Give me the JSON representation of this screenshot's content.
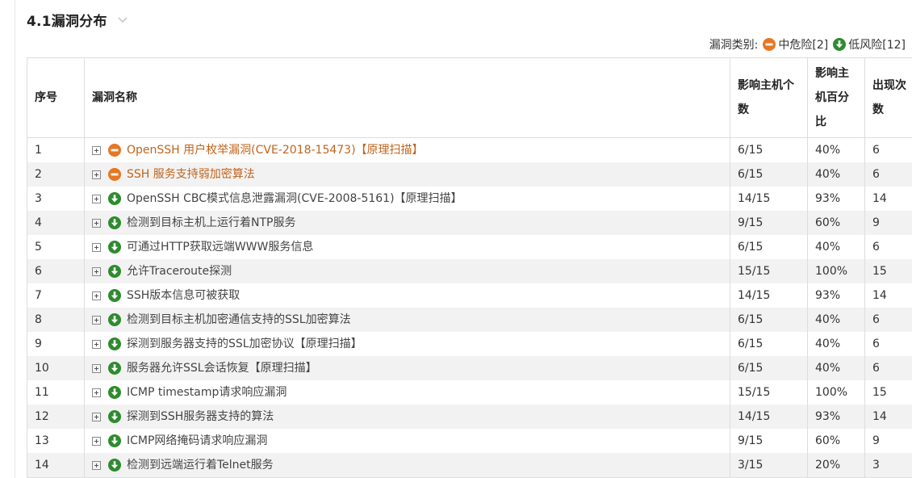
{
  "section": {
    "title": "4.1漏洞分布"
  },
  "legend": {
    "label": "漏洞类别:",
    "medium": {
      "text": "中危险[2]",
      "icon": "medium-risk-icon",
      "color": "#e87722"
    },
    "low": {
      "text": "低风险[12]",
      "icon": "low-risk-icon",
      "color": "#2e8b2e"
    }
  },
  "table": {
    "headers": {
      "index": "序号",
      "name": "漏洞名称",
      "hosts": "影响主机个数",
      "percent": "影响主机百分比",
      "count": "出现次数"
    },
    "rows": [
      {
        "index": "1",
        "level": "medium",
        "name": "OpenSSH 用户枚举漏洞(CVE-2018-15473)【原理扫描】",
        "hosts": "6/15",
        "percent": "40%",
        "count": "6"
      },
      {
        "index": "2",
        "level": "medium",
        "name": "SSH 服务支持弱加密算法",
        "hosts": "6/15",
        "percent": "40%",
        "count": "6"
      },
      {
        "index": "3",
        "level": "low",
        "name": "OpenSSH CBC模式信息泄露漏洞(CVE-2008-5161)【原理扫描】",
        "hosts": "14/15",
        "percent": "93%",
        "count": "14"
      },
      {
        "index": "4",
        "level": "low",
        "name": "检测到目标主机上运行着NTP服务",
        "hosts": "9/15",
        "percent": "60%",
        "count": "9"
      },
      {
        "index": "5",
        "level": "low",
        "name": "可通过HTTP获取远端WWW服务信息",
        "hosts": "6/15",
        "percent": "40%",
        "count": "6"
      },
      {
        "index": "6",
        "level": "low",
        "name": "允许Traceroute探测",
        "hosts": "15/15",
        "percent": "100%",
        "count": "15"
      },
      {
        "index": "7",
        "level": "low",
        "name": "SSH版本信息可被获取",
        "hosts": "14/15",
        "percent": "93%",
        "count": "14"
      },
      {
        "index": "8",
        "level": "low",
        "name": "检测到目标主机加密通信支持的SSL加密算法",
        "hosts": "6/15",
        "percent": "40%",
        "count": "6"
      },
      {
        "index": "9",
        "level": "low",
        "name": "探测到服务器支持的SSL加密协议【原理扫描】",
        "hosts": "6/15",
        "percent": "40%",
        "count": "6"
      },
      {
        "index": "10",
        "level": "low",
        "name": "服务器允许SSL会话恢复【原理扫描】",
        "hosts": "6/15",
        "percent": "40%",
        "count": "6"
      },
      {
        "index": "11",
        "level": "low",
        "name": "ICMP timestamp请求响应漏洞",
        "hosts": "15/15",
        "percent": "100%",
        "count": "15"
      },
      {
        "index": "12",
        "level": "low",
        "name": "探测到SSH服务器支持的算法",
        "hosts": "14/15",
        "percent": "93%",
        "count": "14"
      },
      {
        "index": "13",
        "level": "low",
        "name": "ICMP网络掩码请求响应漏洞",
        "hosts": "9/15",
        "percent": "60%",
        "count": "9"
      },
      {
        "index": "14",
        "level": "low",
        "name": "检测到远端运行着Telnet服务",
        "hosts": "3/15",
        "percent": "20%",
        "count": "3"
      }
    ]
  }
}
